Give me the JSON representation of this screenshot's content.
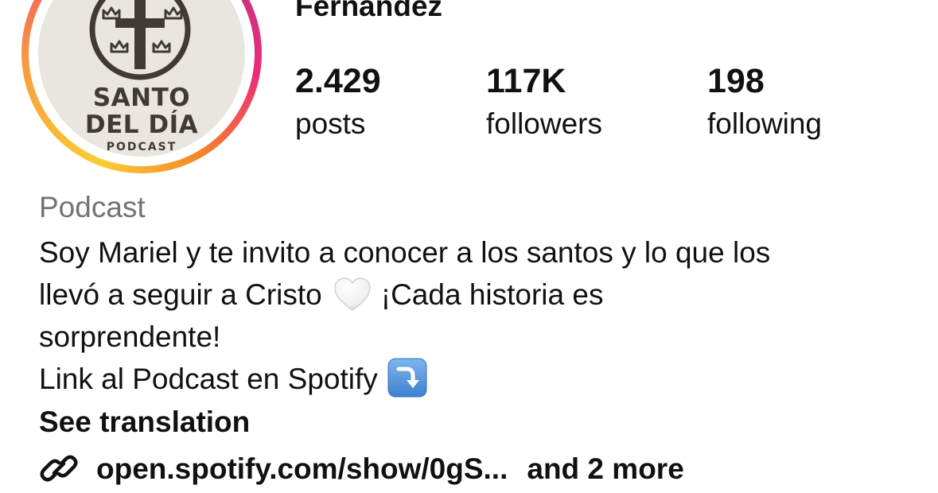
{
  "profile": {
    "name": "Fernández",
    "avatar_logo": {
      "line1": "SANTO",
      "line2": "DEL DÍA",
      "line3": "PODCAST",
      "icon": "cross-with-crowns-icon"
    }
  },
  "stats": {
    "posts_value": "2.429",
    "posts_label": "posts",
    "followers_value": "117K",
    "followers_label": "followers",
    "following_value": "198",
    "following_label": "following"
  },
  "bio": {
    "category": "Podcast",
    "line1": "Soy Mariel y te invito a conocer a los santos y lo que los",
    "line2_before": "llevó a seguir a Cristo",
    "line2_emoji": "white-heart-icon",
    "line2_after": "¡Cada historia es",
    "line3": "sorprendente!",
    "line4_text": "Link al Podcast en Spotify",
    "line4_emoji": "arrow-down-right-icon",
    "see_translation": "See translation"
  },
  "link": {
    "icon": "link-icon",
    "url_text": "open.spotify.com/show/0gS...",
    "more_text": "and 2 more"
  },
  "colors": {
    "text": "#111111",
    "secondary_text": "#737373",
    "ring_yellow": "#f9ce34",
    "ring_pink": "#ee2a7b",
    "ring_purple": "#c13584",
    "avatar_bg": "#e9e6df",
    "logo_brown": "#3f3a33",
    "emoji_arrow_blue": "#4a8fd9"
  }
}
